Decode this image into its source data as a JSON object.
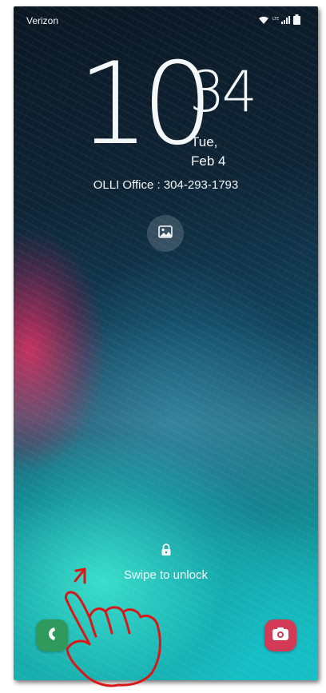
{
  "status_bar": {
    "carrier": "Verizon",
    "icons": [
      "wifi-icon",
      "signal-icon",
      "battery-icon"
    ]
  },
  "clock": {
    "hour": "10",
    "minute": "34",
    "day": "Tue,",
    "date": "Feb 4"
  },
  "owner_info": "OLLI Office : 304-293-1793",
  "wallpaper_button": {
    "icon": "image-icon"
  },
  "unlock": {
    "icon": "lock-icon",
    "label": "Swipe to unlock"
  },
  "shortcuts": {
    "left": {
      "icon": "phone-icon",
      "color": "#2f9a5c"
    },
    "right": {
      "icon": "camera-icon",
      "color": "#d23a55"
    }
  },
  "annotation": {
    "icon": "pointing-hand-icon",
    "color": "#d81818"
  }
}
